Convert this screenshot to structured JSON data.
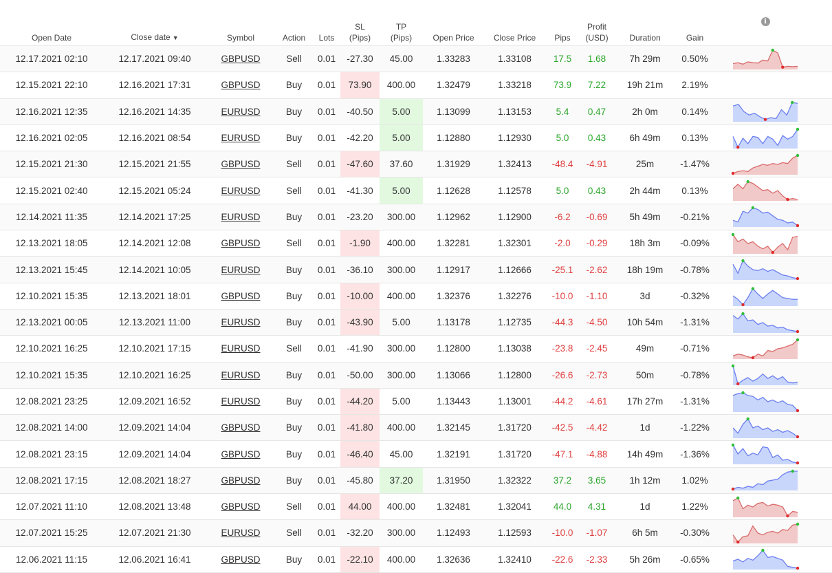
{
  "headers": {
    "open_date": "Open Date",
    "close_date": "Close date",
    "sort_arrow": "▼",
    "symbol": "Symbol",
    "action": "Action",
    "lots": "Lots",
    "sl": "SL",
    "sl_unit": "(Pips)",
    "tp": "TP",
    "tp_unit": "(Pips)",
    "open_price": "Open Price",
    "close_price": "Close Price",
    "pips": "Pips",
    "profit": "Profit",
    "profit_unit": "(USD)",
    "duration": "Duration",
    "gain": "Gain",
    "info": "i"
  },
  "colors": {
    "positive": "#2aa52a",
    "negative": "#e04040",
    "sl_hit_bg": "#fde3e3",
    "tp_hit_bg": "#e2f9e0",
    "spark_buy_fill": "#c9d6fb",
    "spark_buy_line": "#6b7ff0",
    "spark_sell_fill": "#f2c9c9",
    "spark_sell_line": "#d96b6b",
    "spark_high_dot": "#2fbf3a",
    "spark_low_dot": "#e02b2b",
    "comment_icon": "#bbbbbb"
  },
  "rows": [
    {
      "open": "12.17.2021 02:10",
      "close": "12.17.2021 09:40",
      "symbol": "GBPUSD",
      "action": "Sell",
      "lots": "0.01",
      "sl": "-27.30",
      "tp": "45.00",
      "open_price": "1.33283",
      "close_price": "1.33108",
      "pips": "17.5",
      "profit": "1.68",
      "duration": "7h 29m",
      "gain": "0.50%",
      "sl_hit": false,
      "tp_hit": false,
      "spark": [
        0.25,
        0.3,
        0.22,
        0.35,
        0.3,
        0.28,
        0.45,
        0.4,
        1.0,
        0.85,
        0.05,
        0.1,
        0.08,
        0.1
      ]
    },
    {
      "open": "12.15.2021 22:10",
      "close": "12.16.2021 17:31",
      "symbol": "GBPUSD",
      "action": "Buy",
      "lots": "0.01",
      "sl": "73.90",
      "tp": "400.00",
      "open_price": "1.32479",
      "close_price": "1.33218",
      "pips": "73.9",
      "profit": "7.22",
      "duration": "19h 21m",
      "gain": "2.19%",
      "sl_hit": true,
      "tp_hit": false,
      "spark": []
    },
    {
      "open": "12.16.2021 12:35",
      "close": "12.16.2021 14:35",
      "symbol": "EURUSD",
      "action": "Buy",
      "lots": "0.01",
      "sl": "-40.50",
      "tp": "5.00",
      "open_price": "1.13099",
      "close_price": "1.13153",
      "pips": "5.4",
      "profit": "0.47",
      "duration": "2h 0m",
      "gain": "0.14%",
      "sl_hit": false,
      "tp_hit": true,
      "spark": [
        0.8,
        0.9,
        0.5,
        0.3,
        0.4,
        0.2,
        0.05,
        0.15,
        0.1,
        0.6,
        0.3,
        1.0,
        0.95
      ]
    },
    {
      "open": "12.16.2021 02:05",
      "close": "12.16.2021 08:54",
      "symbol": "EURUSD",
      "action": "Buy",
      "lots": "0.01",
      "sl": "-42.20",
      "tp": "5.00",
      "open_price": "1.12880",
      "close_price": "1.12930",
      "pips": "5.0",
      "profit": "0.43",
      "duration": "6h 49m",
      "gain": "0.13%",
      "sl_hit": false,
      "tp_hit": true,
      "spark": [
        0.6,
        0.0,
        0.5,
        0.2,
        0.6,
        0.55,
        0.2,
        0.6,
        0.45,
        0.1,
        0.65,
        0.45,
        0.6,
        1.0
      ]
    },
    {
      "open": "12.15.2021 21:30",
      "close": "12.15.2021 21:55",
      "symbol": "GBPUSD",
      "action": "Sell",
      "lots": "0.01",
      "sl": "-47.60",
      "tp": "37.60",
      "open_price": "1.31929",
      "close_price": "1.32413",
      "pips": "-48.4",
      "profit": "-4.91",
      "duration": "25m",
      "gain": "-1.47%",
      "sl_hit": true,
      "tp_hit": false,
      "spark": [
        0.0,
        0.1,
        0.15,
        0.1,
        0.3,
        0.4,
        0.5,
        0.45,
        0.55,
        0.5,
        0.6,
        0.55,
        0.85,
        1.0
      ]
    },
    {
      "open": "12.15.2021 02:40",
      "close": "12.15.2021 05:24",
      "symbol": "EURUSD",
      "action": "Sell",
      "lots": "0.01",
      "sl": "-41.30",
      "tp": "5.00",
      "open_price": "1.12628",
      "close_price": "1.12578",
      "pips": "5.0",
      "profit": "0.43",
      "duration": "2h 44m",
      "gain": "0.13%",
      "sl_hit": false,
      "tp_hit": true,
      "spark": [
        0.6,
        0.85,
        0.6,
        1.0,
        0.9,
        0.7,
        0.5,
        0.55,
        0.35,
        0.5,
        0.2,
        0.0,
        0.05,
        0.0
      ]
    },
    {
      "open": "12.14.2021 11:35",
      "close": "12.14.2021 17:25",
      "symbol": "EURUSD",
      "action": "Buy",
      "lots": "0.01",
      "sl": "-23.20",
      "tp": "300.00",
      "open_price": "1.12962",
      "close_price": "1.12900",
      "pips": "-6.2",
      "profit": "-0.69",
      "duration": "5h 49m",
      "gain": "-0.21%",
      "sl_hit": false,
      "tp_hit": false,
      "spark": [
        0.3,
        0.2,
        0.8,
        0.7,
        1.0,
        0.9,
        0.7,
        0.75,
        0.55,
        0.35,
        0.3,
        0.15,
        0.2,
        0.0
      ]
    },
    {
      "open": "12.13.2021 18:05",
      "close": "12.14.2021 12:08",
      "symbol": "GBPUSD",
      "action": "Sell",
      "lots": "0.01",
      "sl": "-1.90",
      "tp": "400.00",
      "open_price": "1.32281",
      "close_price": "1.32301",
      "pips": "-2.0",
      "profit": "-0.29",
      "duration": "18h 3m",
      "gain": "-0.09%",
      "sl_hit": true,
      "tp_hit": false,
      "spark": [
        1.0,
        0.6,
        0.75,
        0.5,
        0.6,
        0.35,
        0.2,
        0.35,
        0.0,
        0.3,
        0.5,
        0.15,
        0.85,
        0.9
      ]
    },
    {
      "open": "12.13.2021 15:45",
      "close": "12.14.2021 10:05",
      "symbol": "EURUSD",
      "action": "Buy",
      "lots": "0.01",
      "sl": "-36.10",
      "tp": "300.00",
      "open_price": "1.12917",
      "close_price": "1.12666",
      "pips": "-25.1",
      "profit": "-2.62",
      "duration": "18h 19m",
      "gain": "-0.78%",
      "sl_hit": false,
      "tp_hit": false,
      "spark": [
        0.8,
        0.3,
        1.0,
        0.7,
        0.5,
        0.45,
        0.55,
        0.4,
        0.5,
        0.35,
        0.2,
        0.15,
        0.05,
        0.0
      ]
    },
    {
      "open": "12.10.2021 15:35",
      "close": "12.13.2021 18:01",
      "symbol": "GBPUSD",
      "action": "Buy",
      "lots": "0.01",
      "sl": "-10.00",
      "tp": "400.00",
      "open_price": "1.32376",
      "close_price": "1.32276",
      "pips": "-10.0",
      "profit": "-1.10",
      "duration": "3d",
      "gain": "-0.32%",
      "sl_hit": true,
      "tp_hit": false,
      "spark": [
        0.5,
        0.3,
        0.0,
        0.4,
        0.9,
        0.6,
        0.35,
        0.6,
        0.8,
        0.6,
        0.4,
        0.35,
        0.3,
        0.3
      ]
    },
    {
      "open": "12.13.2021 00:05",
      "close": "12.13.2021 11:00",
      "symbol": "EURUSD",
      "action": "Buy",
      "lots": "0.01",
      "sl": "-43.90",
      "tp": "5.00",
      "open_price": "1.13178",
      "close_price": "1.12735",
      "pips": "-44.3",
      "profit": "-4.50",
      "duration": "10h 54m",
      "gain": "-1.31%",
      "sl_hit": true,
      "tp_hit": false,
      "spark": [
        0.9,
        0.7,
        1.0,
        0.6,
        0.65,
        0.4,
        0.5,
        0.3,
        0.35,
        0.2,
        0.25,
        0.1,
        0.05,
        0.0
      ]
    },
    {
      "open": "12.10.2021 16:25",
      "close": "12.10.2021 17:15",
      "symbol": "EURUSD",
      "action": "Sell",
      "lots": "0.01",
      "sl": "-41.90",
      "tp": "300.00",
      "open_price": "1.12800",
      "close_price": "1.13038",
      "pips": "-23.8",
      "profit": "-2.45",
      "duration": "49m",
      "gain": "-0.71%",
      "sl_hit": false,
      "tp_hit": false,
      "spark": [
        0.1,
        0.2,
        0.15,
        0.05,
        0.0,
        0.2,
        0.1,
        0.4,
        0.35,
        0.5,
        0.55,
        0.65,
        0.75,
        1.0
      ]
    },
    {
      "open": "12.10.2021 15:35",
      "close": "12.10.2021 16:25",
      "symbol": "EURUSD",
      "action": "Buy",
      "lots": "0.01",
      "sl": "-50.00",
      "tp": "300.00",
      "open_price": "1.13066",
      "close_price": "1.12800",
      "pips": "-26.6",
      "profit": "-2.73",
      "duration": "50m",
      "gain": "-0.78%",
      "sl_hit": false,
      "tp_hit": false,
      "spark": [
        1.0,
        0.0,
        0.2,
        0.35,
        0.15,
        0.3,
        0.55,
        0.3,
        0.45,
        0.25,
        0.4,
        0.1,
        0.05,
        0.1
      ]
    },
    {
      "open": "12.08.2021 23:25",
      "close": "12.09.2021 16:52",
      "symbol": "EURUSD",
      "action": "Buy",
      "lots": "0.01",
      "sl": "-44.20",
      "tp": "5.00",
      "open_price": "1.13443",
      "close_price": "1.13001",
      "pips": "-44.2",
      "profit": "-4.61",
      "duration": "17h 27m",
      "gain": "-1.31%",
      "sl_hit": true,
      "tp_hit": false,
      "spark": [
        0.85,
        0.95,
        1.0,
        0.85,
        0.8,
        0.6,
        0.75,
        0.5,
        0.6,
        0.45,
        0.55,
        0.35,
        0.3,
        0.0
      ]
    },
    {
      "open": "12.08.2021 14:00",
      "close": "12.09.2021 14:04",
      "symbol": "GBPUSD",
      "action": "Buy",
      "lots": "0.01",
      "sl": "-41.80",
      "tp": "400.00",
      "open_price": "1.32145",
      "close_price": "1.31720",
      "pips": "-42.5",
      "profit": "-4.42",
      "duration": "1d",
      "gain": "-1.22%",
      "sl_hit": true,
      "tp_hit": false,
      "spark": [
        0.5,
        0.2,
        0.7,
        1.0,
        0.5,
        0.6,
        0.4,
        0.5,
        0.3,
        0.4,
        0.25,
        0.35,
        0.2,
        0.0
      ]
    },
    {
      "open": "12.08.2021 23:15",
      "close": "12.09.2021 14:04",
      "symbol": "GBPUSD",
      "action": "Buy",
      "lots": "0.01",
      "sl": "-46.40",
      "tp": "45.00",
      "open_price": "1.32191",
      "close_price": "1.31720",
      "pips": "-47.1",
      "profit": "-4.88",
      "duration": "14h 49m",
      "gain": "-1.36%",
      "sl_hit": true,
      "tp_hit": false,
      "spark": [
        1.0,
        0.5,
        0.8,
        0.4,
        0.55,
        0.45,
        0.9,
        0.85,
        0.3,
        0.45,
        0.15,
        0.2,
        0.05,
        0.0
      ]
    },
    {
      "open": "12.08.2021 17:15",
      "close": "12.08.2021 18:27",
      "symbol": "GBPUSD",
      "action": "Buy",
      "lots": "0.01",
      "sl": "-45.80",
      "tp": "37.20",
      "open_price": "1.31950",
      "close_price": "1.32322",
      "pips": "37.2",
      "profit": "3.65",
      "duration": "1h 12m",
      "gain": "1.02%",
      "sl_hit": false,
      "tp_hit": true,
      "spark": [
        0.0,
        0.1,
        0.05,
        0.15,
        0.1,
        0.3,
        0.25,
        0.45,
        0.5,
        0.55,
        0.8,
        0.95,
        1.0,
        1.0
      ]
    },
    {
      "open": "12.07.2021 11:10",
      "close": "12.08.2021 13:48",
      "symbol": "GBPUSD",
      "action": "Sell",
      "lots": "0.01",
      "sl": "44.00",
      "tp": "400.00",
      "open_price": "1.32481",
      "close_price": "1.32041",
      "pips": "44.0",
      "profit": "4.31",
      "duration": "1d",
      "gain": "1.22%",
      "sl_hit": true,
      "tp_hit": false,
      "spark": [
        0.85,
        1.0,
        0.4,
        0.6,
        0.5,
        0.7,
        0.75,
        0.55,
        0.65,
        0.6,
        0.5,
        0.0,
        0.25,
        0.2
      ]
    },
    {
      "open": "12.07.2021 15:25",
      "close": "12.07.2021 21:30",
      "symbol": "EURUSD",
      "action": "Sell",
      "lots": "0.01",
      "sl": "-32.20",
      "tp": "300.00",
      "open_price": "1.12493",
      "close_price": "1.12593",
      "pips": "-10.0",
      "profit": "-1.07",
      "duration": "6h 5m",
      "gain": "-0.30%",
      "sl_hit": false,
      "tp_hit": false,
      "spark": [
        0.4,
        0.0,
        0.3,
        0.35,
        0.9,
        0.5,
        0.4,
        0.55,
        0.6,
        0.5,
        0.7,
        0.65,
        0.95,
        1.0
      ]
    },
    {
      "open": "12.06.2021 11:15",
      "close": "12.06.2021 16:41",
      "symbol": "GBPUSD",
      "action": "Buy",
      "lots": "0.01",
      "sl": "-22.10",
      "tp": "400.00",
      "open_price": "1.32636",
      "close_price": "1.32410",
      "pips": "-22.6",
      "profit": "-2.33",
      "duration": "5h 26m",
      "gain": "-0.65%",
      "sl_hit": true,
      "tp_hit": false,
      "spark": [
        0.4,
        0.5,
        0.35,
        0.55,
        0.45,
        0.7,
        1.0,
        0.6,
        0.65,
        0.55,
        0.45,
        0.1,
        0.05,
        0.0
      ]
    }
  ]
}
